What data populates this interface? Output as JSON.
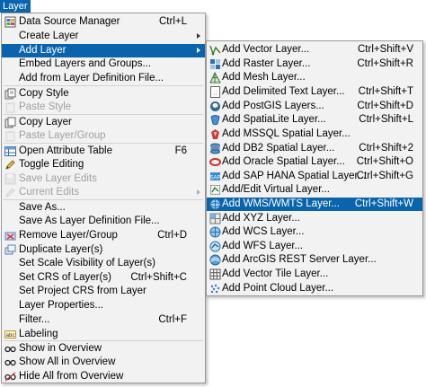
{
  "menubar": {
    "title": "Layer",
    "highlight_color": "#0a64ad"
  },
  "main_menu": {
    "items": [
      {
        "label": "Data Source Manager",
        "shortcut": "Ctrl+L",
        "icon": "data-source-manager-icon"
      },
      {
        "label": "Create Layer",
        "submenu": true
      },
      {
        "label": "Add Layer",
        "submenu": true,
        "highlighted": true
      },
      {
        "label": "Embed Layers and Groups..."
      },
      {
        "label": "Add from Layer Definition File..."
      },
      {
        "label": "Copy Style",
        "icon": "copy-style-icon"
      },
      {
        "label": "Paste Style",
        "disabled": true,
        "icon": "paste-style-icon"
      },
      {
        "label": "Copy Layer",
        "icon": "copy-layer-icon"
      },
      {
        "label": "Paste Layer/Group",
        "disabled": true,
        "icon": "paste-layer-icon"
      },
      {
        "label": "Open Attribute Table",
        "shortcut": "F6",
        "icon": "attribute-table-icon"
      },
      {
        "label": "Toggle Editing",
        "icon": "pencil-icon"
      },
      {
        "label": "Save Layer Edits",
        "disabled": true,
        "icon": "save-edits-icon"
      },
      {
        "label": "Current Edits",
        "disabled": true,
        "submenu": true,
        "icon": "current-edits-icon"
      },
      {
        "label": "Save As..."
      },
      {
        "label": "Save As Layer Definition File..."
      },
      {
        "label": "Remove Layer/Group",
        "shortcut": "Ctrl+D",
        "icon": "remove-layer-icon"
      },
      {
        "label": "Duplicate Layer(s)",
        "icon": "duplicate-layer-icon"
      },
      {
        "label": "Set Scale Visibility of Layer(s)"
      },
      {
        "label": "Set CRS of Layer(s)",
        "shortcut": "Ctrl+Shift+C"
      },
      {
        "label": "Set Project CRS from Layer"
      },
      {
        "label": "Layer Properties..."
      },
      {
        "label": "Filter...",
        "shortcut": "Ctrl+F"
      },
      {
        "label": "Labeling",
        "icon": "labeling-icon"
      },
      {
        "label": "Show in Overview",
        "icon": "overview-icon"
      },
      {
        "label": "Show All in Overview",
        "icon": "overview-all-icon"
      },
      {
        "label": "Hide All from Overview",
        "icon": "overview-hide-icon"
      }
    ]
  },
  "add_layer_submenu": {
    "items": [
      {
        "label": "Add Vector Layer...",
        "shortcut": "Ctrl+Shift+V",
        "icon": "vector-layer-icon"
      },
      {
        "label": "Add Raster Layer...",
        "shortcut": "Ctrl+Shift+R",
        "icon": "raster-layer-icon"
      },
      {
        "label": "Add Mesh Layer...",
        "icon": "mesh-layer-icon"
      },
      {
        "label": "Add Delimited Text Layer...",
        "shortcut": "Ctrl+Shift+T",
        "icon": "delimited-text-icon"
      },
      {
        "label": "Add PostGIS Layers...",
        "shortcut": "Ctrl+Shift+D",
        "icon": "postgis-icon"
      },
      {
        "label": "Add SpatiaLite Layer...",
        "shortcut": "Ctrl+Shift+L",
        "icon": "spatialite-icon"
      },
      {
        "label": "Add MSSQL Spatial Layer...",
        "icon": "mssql-icon"
      },
      {
        "label": "Add DB2 Spatial Layer...",
        "shortcut": "Ctrl+Shift+2",
        "icon": "db2-icon"
      },
      {
        "label": "Add Oracle Spatial Layer...",
        "shortcut": "Ctrl+Shift+O",
        "icon": "oracle-icon"
      },
      {
        "label": "Add SAP HANA Spatial Layer...",
        "shortcut": "Ctrl+Shift+G",
        "icon": "hana-icon"
      },
      {
        "label": "Add/Edit Virtual Layer...",
        "icon": "virtual-layer-icon"
      },
      {
        "label": "Add WMS/WMTS Layer...",
        "shortcut": "Ctrl+Shift+W",
        "highlighted": true,
        "icon": "wms-icon"
      },
      {
        "label": "Add XYZ Layer...",
        "icon": "xyz-icon"
      },
      {
        "label": "Add WCS Layer...",
        "icon": "wcs-icon"
      },
      {
        "label": "Add WFS Layer...",
        "icon": "wfs-icon"
      },
      {
        "label": "Add ArcGIS REST Server Layer...",
        "icon": "arcgis-icon"
      },
      {
        "label": "Add Vector Tile Layer...",
        "icon": "vector-tile-icon"
      },
      {
        "label": "Add Point Cloud Layer...",
        "icon": "point-cloud-icon"
      }
    ]
  }
}
